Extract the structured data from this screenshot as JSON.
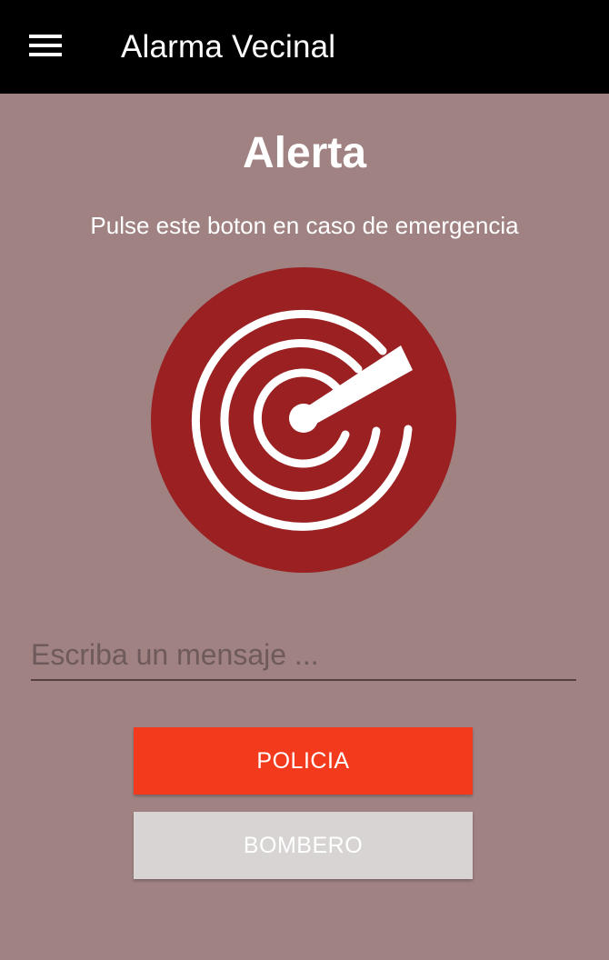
{
  "appbar": {
    "title": "Alarma Vecinal",
    "menu_icon": "hamburger-menu-icon"
  },
  "main": {
    "heading": "Alerta",
    "subtitle": "Pulse este boton en caso de emergencia",
    "alert_icon": "radar-icon",
    "message": {
      "value": "",
      "placeholder": "Escriba un mensaje ..."
    },
    "buttons": {
      "policia": "POLICIA",
      "bombero": "BOMBERO"
    }
  },
  "colors": {
    "appbar": "#000000",
    "background": "#a08282",
    "alert_circle": "#9a2022",
    "policia_button": "#f33a1d",
    "bombero_button": "#d8d4d3"
  }
}
